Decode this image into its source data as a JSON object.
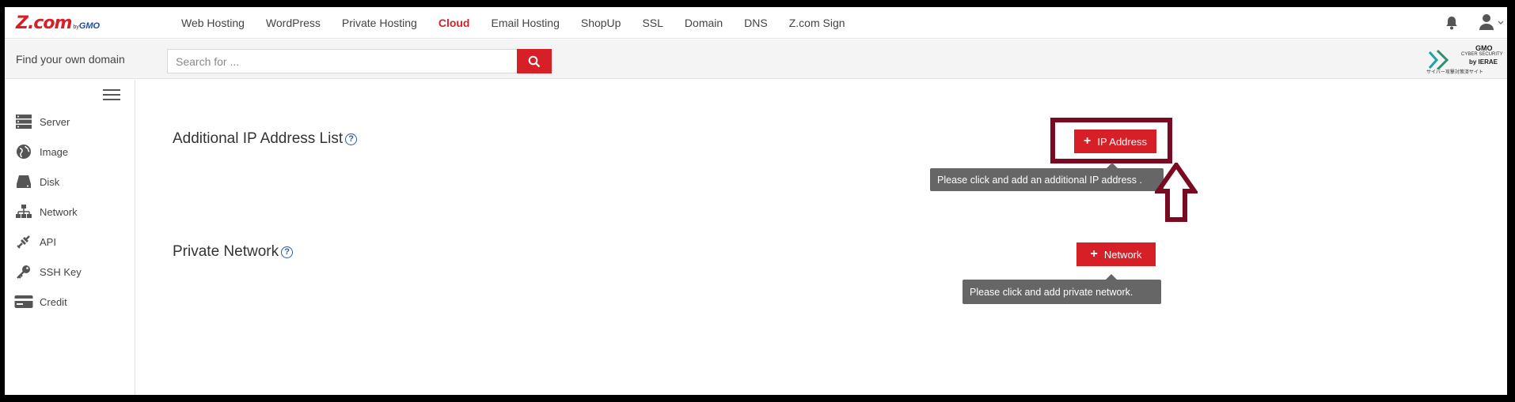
{
  "nav": {
    "logo_main": "Z.com",
    "logo_by": "by",
    "logo_gmo": "GMO",
    "links": [
      {
        "label": "Web Hosting",
        "active": false
      },
      {
        "label": "WordPress",
        "active": false
      },
      {
        "label": "Private Hosting",
        "active": false
      },
      {
        "label": "Cloud",
        "active": true
      },
      {
        "label": "Email Hosting",
        "active": false
      },
      {
        "label": "ShopUp",
        "active": false
      },
      {
        "label": "SSL",
        "active": false
      },
      {
        "label": "Domain",
        "active": false
      },
      {
        "label": "DNS",
        "active": false
      },
      {
        "label": "Z.com Sign",
        "active": false
      }
    ]
  },
  "search": {
    "label": "Find your own domain",
    "placeholder": "Search for ..."
  },
  "badge": {
    "gmo": "GMO",
    "cyber": "CYBER SECURITY",
    "ierae": "by IERAE",
    "jp": "サイバー攻撃対策済サイト"
  },
  "sidebar": {
    "items": [
      {
        "label": "Server",
        "icon": "server-icon"
      },
      {
        "label": "Image",
        "icon": "globe-icon"
      },
      {
        "label": "Disk",
        "icon": "disk-icon"
      },
      {
        "label": "Network",
        "icon": "network-icon"
      },
      {
        "label": "API",
        "icon": "api-icon"
      },
      {
        "label": "SSH Key",
        "icon": "key-icon"
      },
      {
        "label": "Credit",
        "icon": "credit-card-icon"
      }
    ]
  },
  "main": {
    "ip_section": {
      "title": "Additional IP Address List",
      "button": "IP Address",
      "tooltip": "Please click and add an additional IP address ."
    },
    "network_section": {
      "title": "Private Network",
      "button": "Network",
      "tooltip": "Please click and add private network."
    }
  },
  "colors": {
    "brand_red": "#d71f28",
    "annotation": "#7a0a22",
    "tooltip_bg": "#666666"
  }
}
